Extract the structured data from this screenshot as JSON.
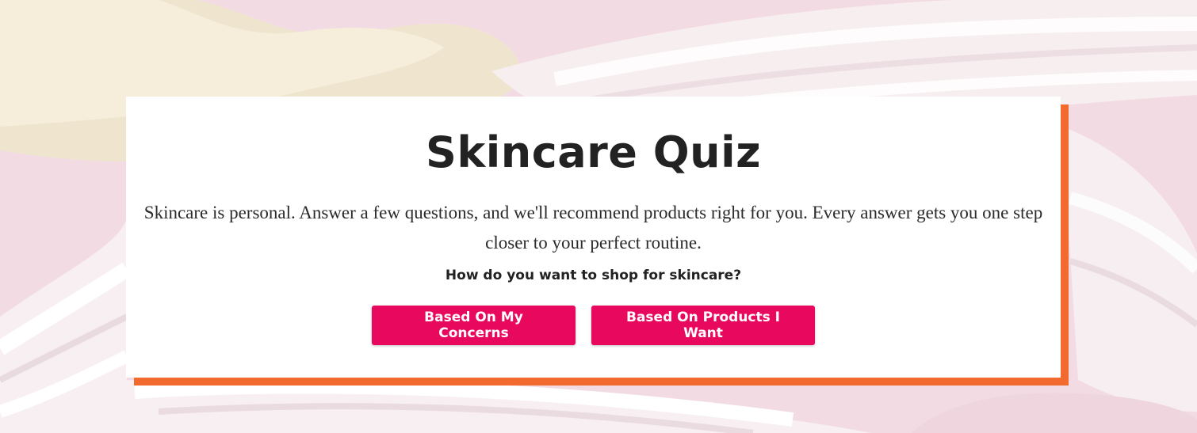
{
  "quiz": {
    "title": "Skincare Quiz",
    "description": "Skincare is personal. Answer a few questions, and we'll recommend products right for you. Every answer gets you one step closer to your perfect routine.",
    "question": "How do you want to shop for skincare?",
    "options": [
      {
        "label": "Based On My Concerns"
      },
      {
        "label": "Based On Products I Want"
      }
    ]
  },
  "colors": {
    "background_pink": "#f3dbe3",
    "cream_swirl": "#fbf5f3",
    "accent_orange": "#f26a2e",
    "button_pink": "#e8095f",
    "heading_text": "#222222"
  }
}
